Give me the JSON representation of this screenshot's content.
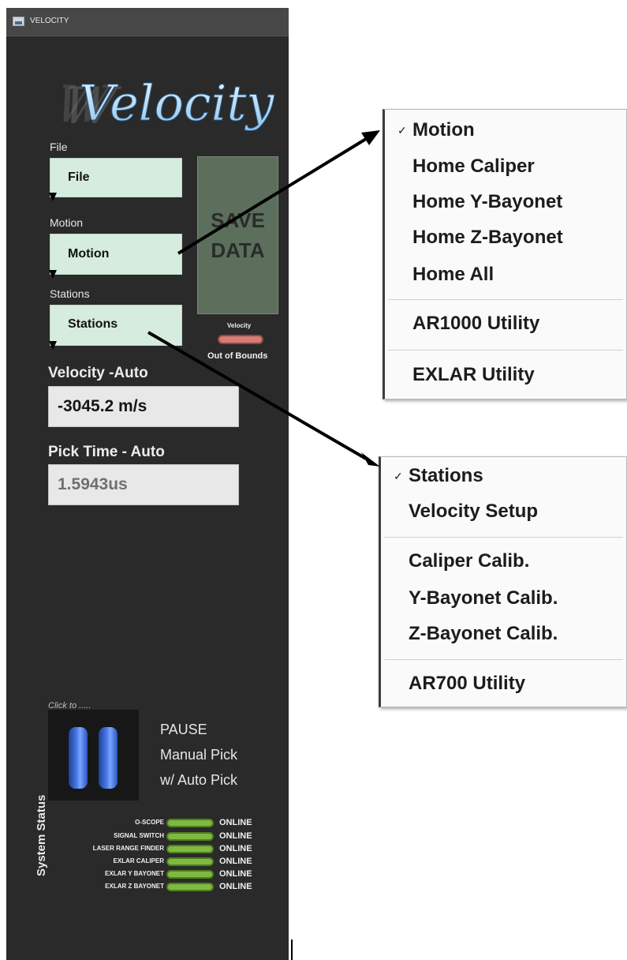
{
  "window": {
    "title": "VELOCITY",
    "logo_text": "Velocity"
  },
  "file": {
    "label": "File",
    "button": "File"
  },
  "motion": {
    "label": "Motion",
    "button": "Motion"
  },
  "stations": {
    "label": "Stations",
    "button": "Stations"
  },
  "save_button": {
    "line1": "SAVE",
    "line2": "DATA"
  },
  "oob_indicator": {
    "title": "Velocity",
    "text": "Out of Bounds",
    "color": "#d57c74"
  },
  "velocity": {
    "heading": "Velocity -Auto",
    "value": "-3045.2 m/s"
  },
  "pick_time": {
    "heading": "Pick Time - Auto",
    "value": "1.5943us"
  },
  "pause": {
    "hint": "Click to .....",
    "line1": "PAUSE",
    "line2": "Manual Pick",
    "line3": "w/ Auto Pick"
  },
  "system_status": {
    "title": "System Status",
    "items": [
      {
        "name": "O-SCOPE",
        "status": "ONLINE"
      },
      {
        "name": "SIGNAL SWITCH",
        "status": "ONLINE"
      },
      {
        "name": "LASER RANGE FINDER",
        "status": "ONLINE"
      },
      {
        "name": "EXLAR CALIPER",
        "status": "ONLINE"
      },
      {
        "name": "EXLAR Y BAYONET",
        "status": "ONLINE"
      },
      {
        "name": "EXLAR Z BAYONET",
        "status": "ONLINE"
      }
    ],
    "online_color": "#7fb93f"
  },
  "motion_menu": {
    "check": "✓",
    "items": [
      "Motion",
      "Home Caliper",
      "Home Y-Bayonet",
      "Home Z-Bayonet",
      "Home All",
      "AR1000 Utility",
      "EXLAR Utility"
    ]
  },
  "stations_menu": {
    "check": "✓",
    "items": [
      "Stations",
      "Velocity Setup",
      "Caliper Calib.",
      "Y-Bayonet Calib.",
      "Z-Bayonet Calib.",
      "AR700 Utility"
    ]
  }
}
